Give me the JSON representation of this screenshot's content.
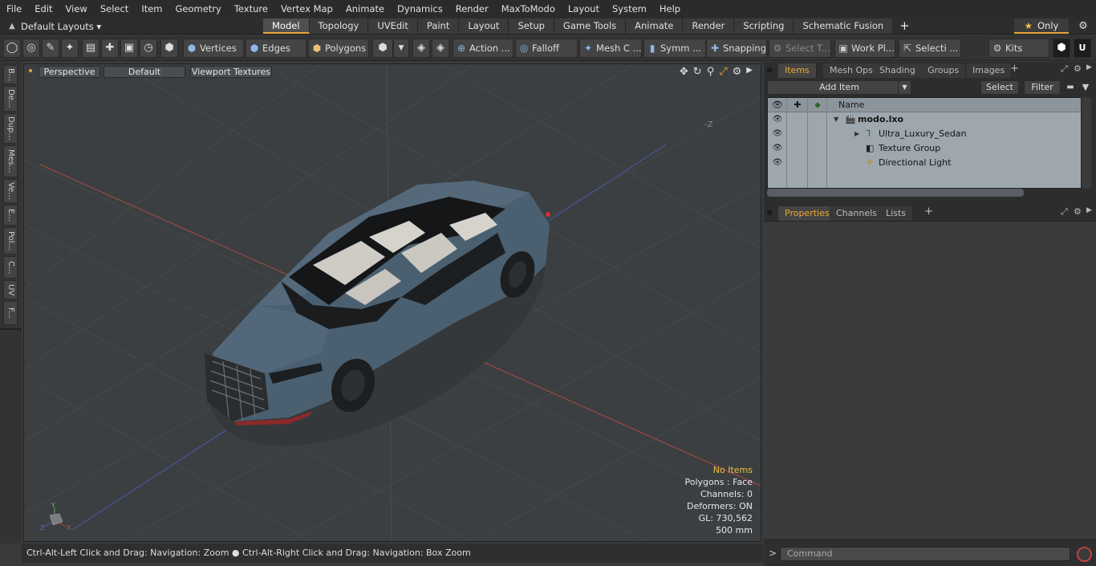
{
  "menu": [
    "File",
    "Edit",
    "View",
    "Select",
    "Item",
    "Geometry",
    "Texture",
    "Vertex Map",
    "Animate",
    "Dynamics",
    "Render",
    "MaxToModo",
    "Layout",
    "System",
    "Help"
  ],
  "layout_selector": "Default Layouts ▾",
  "layout_tabs": [
    {
      "label": "Model",
      "active": true
    },
    {
      "label": "Topology"
    },
    {
      "label": "UVEdit"
    },
    {
      "label": "Paint"
    },
    {
      "label": "Layout"
    },
    {
      "label": "Setup"
    },
    {
      "label": "Game Tools"
    },
    {
      "label": "Animate"
    },
    {
      "label": "Render"
    },
    {
      "label": "Scripting"
    },
    {
      "label": "Schematic Fusion"
    }
  ],
  "only_label": "Only",
  "toolbar": {
    "vertices": "Vertices",
    "edges": "Edges",
    "polygons": "Polygons",
    "action": "Action ...",
    "falloff": "Falloff",
    "mesh": "Mesh C ...",
    "symm": "Symm ...",
    "snapping": "Snapping",
    "select_t": "Select T...",
    "work_pl": "Work Pl...",
    "selecti": "Selecti ...",
    "kits": "Kits"
  },
  "left_tabs": [
    "B...",
    "De...",
    "Dup...",
    "Mes...",
    "Ve...",
    "E...",
    "Pol...",
    "C...",
    "UV",
    "F..."
  ],
  "viewport": {
    "view": "Perspective",
    "shading": "Default",
    "textures": "Viewport Textures",
    "minus_z": "-Z",
    "info": {
      "selection": "No Items",
      "polygons": "Polygons : Face",
      "channels": "Channels: 0",
      "deformers": "Deformers: ON",
      "gl": "GL: 730,562",
      "scale": "500 mm"
    }
  },
  "status": {
    "left": "Ctrl-Alt-Left Click and Drag: Navigation: Zoom",
    "right": "Ctrl-Alt-Right Click and Drag: Navigation: Box Zoom"
  },
  "items_panel": {
    "tabs": [
      "Items",
      "Mesh Ops",
      "Shading",
      "Groups",
      "Images"
    ],
    "add_item": "Add Item",
    "select": "Select",
    "filter": "Filter",
    "name_header": "Name",
    "rows": [
      {
        "name": "modo.lxo",
        "icon": "scene-icon"
      },
      {
        "name": "Ultra_Luxury_Sedan",
        "icon": "mesh-icon"
      },
      {
        "name": "Texture Group",
        "icon": "texture-group-icon"
      },
      {
        "name": "Directional Light",
        "icon": "light-icon"
      }
    ]
  },
  "props_panel": {
    "tabs": [
      "Properties",
      "Channels",
      "Lists"
    ]
  },
  "command": {
    "placeholder": "Command",
    "prompt": ">"
  },
  "colors": {
    "accent": "#e8a53b",
    "viewport_bg": "#3b3f42",
    "car_body": "#4a6070",
    "list_bg": "#9ea6ae"
  }
}
